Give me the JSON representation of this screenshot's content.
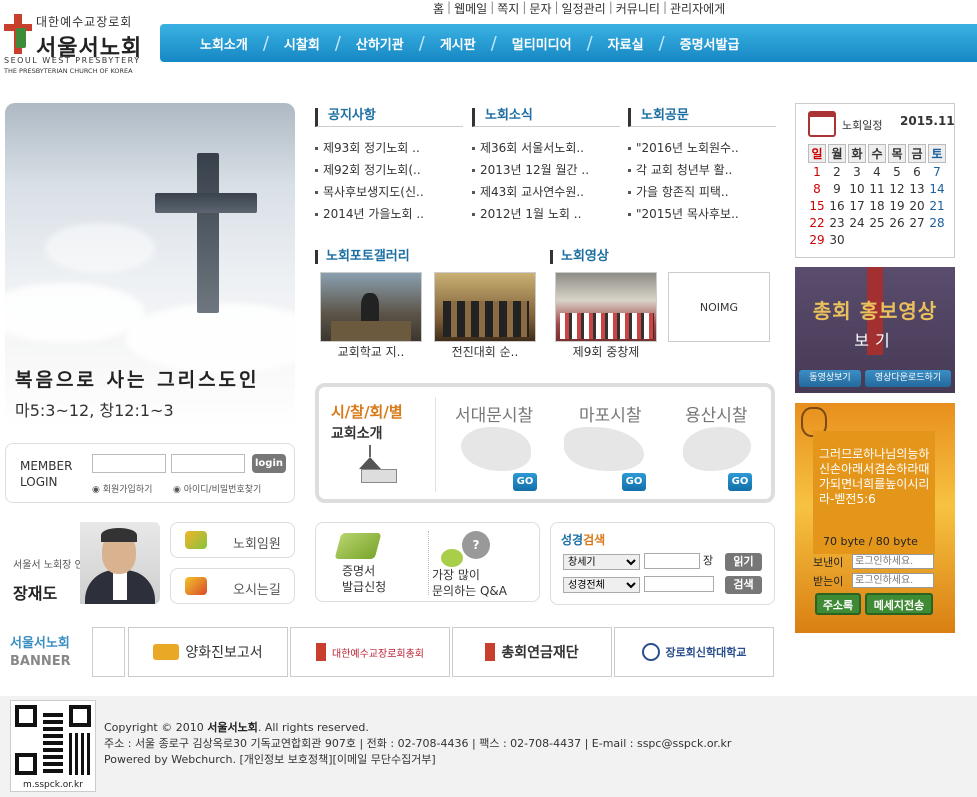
{
  "util_menu": [
    "홈",
    "웹메일",
    "쪽지",
    "문자",
    "일정관리",
    "커뮤니티",
    "관리자에게"
  ],
  "logo": {
    "small": "대한예수교장로회",
    "big": "서울서노회",
    "eng1": "SEOUL WEST PRESBYTERY",
    "eng2": "THE PRESBYTERIAN CHURCH OF KOREA"
  },
  "nav": [
    "노회소개",
    "시찰회",
    "산하기관",
    "게시판",
    "멀티미디어",
    "자료실",
    "증명서발급"
  ],
  "hero": {
    "title": "복음으로 사는 그리스도인",
    "verse": "마5:3~12, 창12:1~3"
  },
  "login": {
    "label1": "MEMBER",
    "label2": "LOGIN",
    "button": "login",
    "join": "회원가입하기",
    "find": "아이디/비밀번호찾기"
  },
  "greeting": {
    "caption": "서울서 노회장 인사말",
    "name": "장재도"
  },
  "quick": {
    "officers": "노회임원",
    "directions": "오시는길"
  },
  "banner_label": {
    "title": "서울서노회",
    "sub": "BANNER"
  },
  "banners": [
    "양화진보고서",
    "대한예수교장로회총회",
    "총회연금재단",
    "장로회신학대학교"
  ],
  "boards": [
    {
      "title": "공지사항",
      "items": [
        "제93회 정기노회 ..",
        "제92회 정기노회(..",
        "목사후보생지도(신..",
        "2014년 가을노회 .."
      ]
    },
    {
      "title": "노회소식",
      "items": [
        "제36회 서울서노회..",
        "2013년 12월 월간 ..",
        "제43회 교사연수원..",
        "2012년 1월 노회 .."
      ]
    },
    {
      "title": "노회공문",
      "items": [
        "\"2016년 노회원수..",
        "각 교회 청년부 활..",
        "가을 항존직 피택..",
        "\"2015년 목사후보.."
      ]
    }
  ],
  "gallery": {
    "title": "노회포토갤러리",
    "items": [
      "교회학교 지..",
      "전진대회 순.."
    ]
  },
  "video": {
    "title": "노회영상",
    "items": [
      "제9회 중창제"
    ],
    "noimg": "NOIMG"
  },
  "church_intro": {
    "t1": "시/찰/회/별",
    "t2": "교회소개",
    "districts": [
      "서대문시찰",
      "마포시찰",
      "용산시찰"
    ],
    "go": "GO"
  },
  "cert": {
    "line1a": "증명서",
    "line1b": "발급신청",
    "line2a": "가장 많이",
    "line2b": "문의하는 Q&A"
  },
  "bible": {
    "title_a": "성경",
    "title_b": "검색",
    "select1": "창세기",
    "select2": "성경전체",
    "jang": "장",
    "read": "읽기",
    "search": "검색"
  },
  "calendar": {
    "title": "노회일정",
    "ym": "2015.11",
    "weekdays": [
      "일",
      "월",
      "화",
      "수",
      "목",
      "금",
      "토"
    ],
    "weeks": [
      [
        "1",
        "2",
        "3",
        "4",
        "5",
        "6",
        "7"
      ],
      [
        "8",
        "9",
        "10",
        "11",
        "12",
        "13",
        "14"
      ],
      [
        "15",
        "16",
        "17",
        "18",
        "19",
        "20",
        "21"
      ],
      [
        "22",
        "23",
        "24",
        "25",
        "26",
        "27",
        "28"
      ],
      [
        "29",
        "30",
        "",
        "",
        "",
        "",
        ""
      ]
    ]
  },
  "promo": {
    "t1": "총회 홍보영상",
    "t2": "보기",
    "b1": "동영상보기",
    "b2": "영상다운로드하기"
  },
  "widget": {
    "text": "그러므로하나님의능하신손아래서겸손하라때가되면너희를높이시리라-벧전5:6",
    "count": "70  byte / 80 byte",
    "label1": "보낸이",
    "label2": "받는이",
    "placeholder": "로그인하세요.",
    "btn1": "주소록",
    "btn2": "메세지전송"
  },
  "footer": {
    "copyright_a": "Copyright © 2010 ",
    "copyright_b": "서울서노회",
    "copyright_c": ". All rights reserved.",
    "address": "주소 : 서울 종로구 김상옥로30 기독교연합회관 907호 | 전화 : 02-708-4436 | 팩스 : 02-708-4437 | E-mail : sspc@sspck.or.kr",
    "powered": "Powered by Webchurch. [개인정보 보호정책][이메일 무단수집거부]",
    "qr_label": "m.sspck.or.kr"
  },
  "colors": {
    "nav": "#1f99d3",
    "accent": "#1d6fa3",
    "orange": "#d97a1a"
  }
}
